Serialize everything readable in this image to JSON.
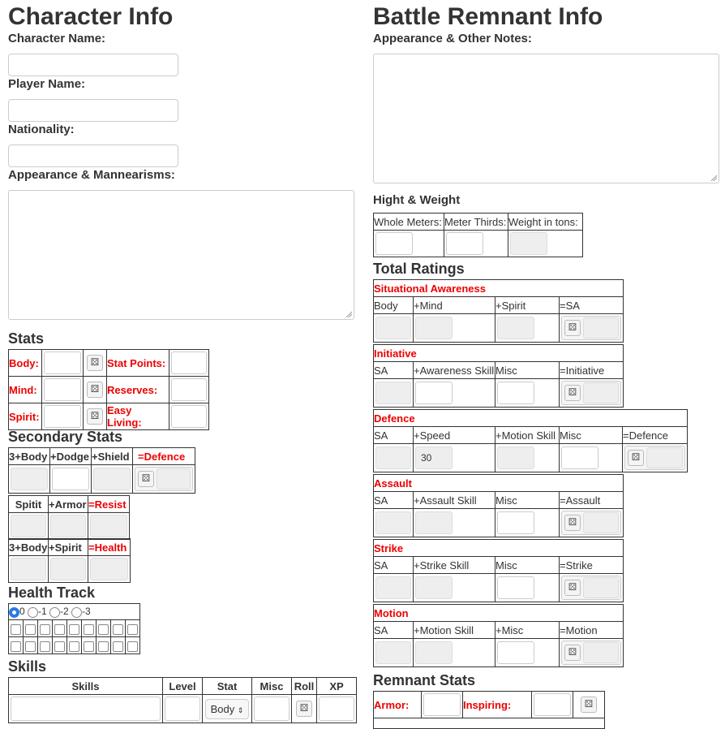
{
  "left": {
    "title": "Character Info",
    "character_name_label": "Character Name:",
    "player_name_label": "Player Name:",
    "nationality_label": "Nationality:",
    "appearance_label": "Appearance & Mannearisms:",
    "stats": {
      "heading": "Stats",
      "body": "Body:",
      "mind": "Mind:",
      "spirit": "Spirit:",
      "stat_points": "Stat Points:",
      "reserves": "Reserves:",
      "easy_living": "Easy Living:"
    },
    "secondary": {
      "heading": "Secondary Stats",
      "defence_headers": [
        "3+Body",
        "+Dodge",
        "+Shield",
        "=Defence"
      ],
      "resist_headers": [
        "Spitit",
        "+Armor",
        "=Resist"
      ],
      "health_headers": [
        "3+Body",
        "+Spirit",
        "=Health"
      ]
    },
    "health_track": {
      "heading": "Health Track",
      "radios": [
        "0",
        "-1",
        "-2",
        "-3"
      ],
      "selected": "0"
    },
    "skills": {
      "heading": "Skills",
      "headers": [
        "Skills",
        "Level",
        "Stat",
        "Misc",
        "Roll",
        "XP"
      ],
      "stat_value": "Body"
    }
  },
  "right": {
    "title": "Battle Remnant Info",
    "appearance_label": "Appearance & Other Notes:",
    "hw": {
      "heading": "Hight & Weight",
      "headers": [
        "Whole Meters:",
        "Meter Thirds:",
        "Weight in tons:"
      ]
    },
    "totals": {
      "heading": "Total Ratings",
      "sa": {
        "title": "Situational Awareness",
        "headers": [
          "Body",
          "+Mind",
          "+Spirit",
          "=SA"
        ]
      },
      "initiative": {
        "title": "Initiative",
        "headers": [
          "SA",
          "+Awareness Skill",
          "Misc",
          "=Initiative"
        ]
      },
      "defence": {
        "title": "Defence",
        "headers": [
          "SA",
          "+Speed",
          "+Motion Skill",
          "Misc",
          "=Defence"
        ],
        "speed_value": "30"
      },
      "assault": {
        "title": "Assault",
        "headers": [
          "SA",
          "+Assault Skill",
          "Misc",
          "=Assault"
        ]
      },
      "strike": {
        "title": "Strike",
        "headers": [
          "SA",
          "+Strike Skill",
          "Misc",
          "=Strike"
        ]
      },
      "motion": {
        "title": "Motion",
        "headers": [
          "SA",
          "+Motion Skill",
          "+Misc",
          "=Motion"
        ]
      }
    },
    "remnant": {
      "heading": "Remnant Stats",
      "armor": "Armor:",
      "inspiring": "Inspiring:"
    }
  },
  "icons": {
    "die": "d20-dice-icon"
  }
}
